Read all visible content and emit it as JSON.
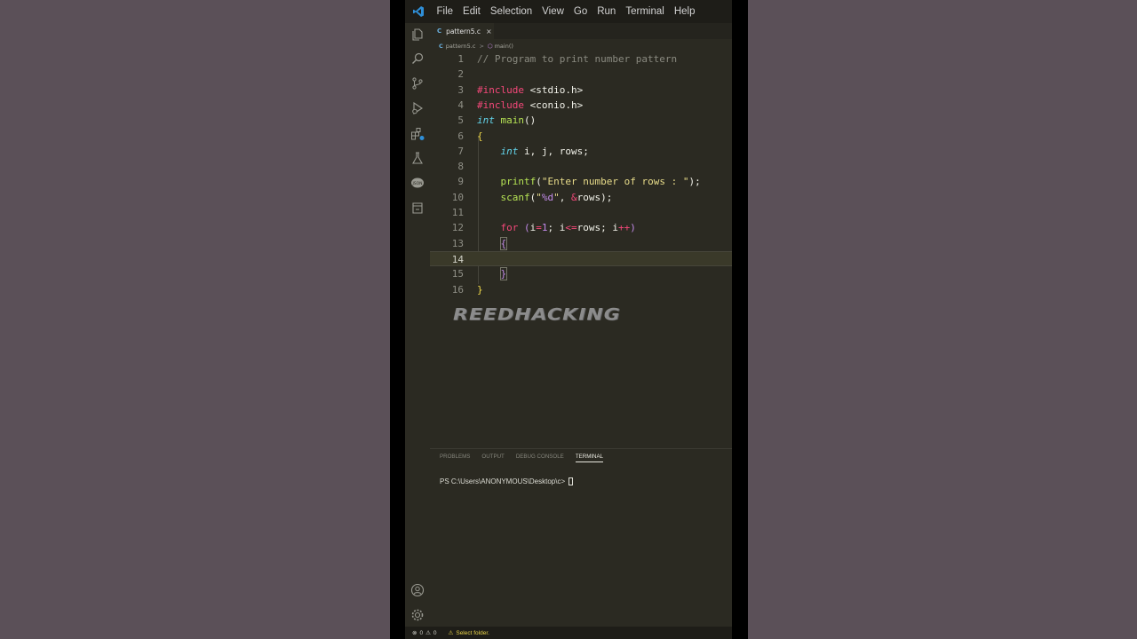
{
  "menu": [
    "File",
    "Edit",
    "Selection",
    "View",
    "Go",
    "Run",
    "Terminal",
    "Help"
  ],
  "tab": {
    "label": "pattern5.c",
    "close": "×",
    "lang_mark": "C"
  },
  "breadcrumb": {
    "file": "pattern5.c",
    "symbol": "main()",
    "lang_mark": "C",
    "separator": ">"
  },
  "editor": {
    "current_line": 14,
    "line_numbers": [
      "1",
      "2",
      "3",
      "4",
      "5",
      "6",
      "7",
      "8",
      "9",
      "10",
      "11",
      "12",
      "13",
      "14",
      "15",
      "16"
    ]
  },
  "watermark": "REEDHACKING",
  "panel": {
    "tabs": [
      "PROBLEMS",
      "OUTPUT",
      "DEBUG CONSOLE",
      "TERMINAL"
    ],
    "active_tab": "TERMINAL",
    "terminal_prompt": "PS C:\\Users\\ANONYMOUS\\Desktop\\c>"
  },
  "status": {
    "errors": "0",
    "warnings": "0",
    "message": "Select folder."
  },
  "colors": {
    "accent": "#6ab0de",
    "keyword_pink": "#f5487a",
    "function_green": "#b6e354",
    "editor_bg": "#2b2a22"
  },
  "icons": [
    "vscode-logo-icon",
    "explorer-icon",
    "search-icon",
    "source-control-icon",
    "run-debug-icon",
    "extensions-icon",
    "testing-icon",
    "json-icon",
    "remote-icon",
    "account-icon",
    "settings-gear-icon"
  ]
}
